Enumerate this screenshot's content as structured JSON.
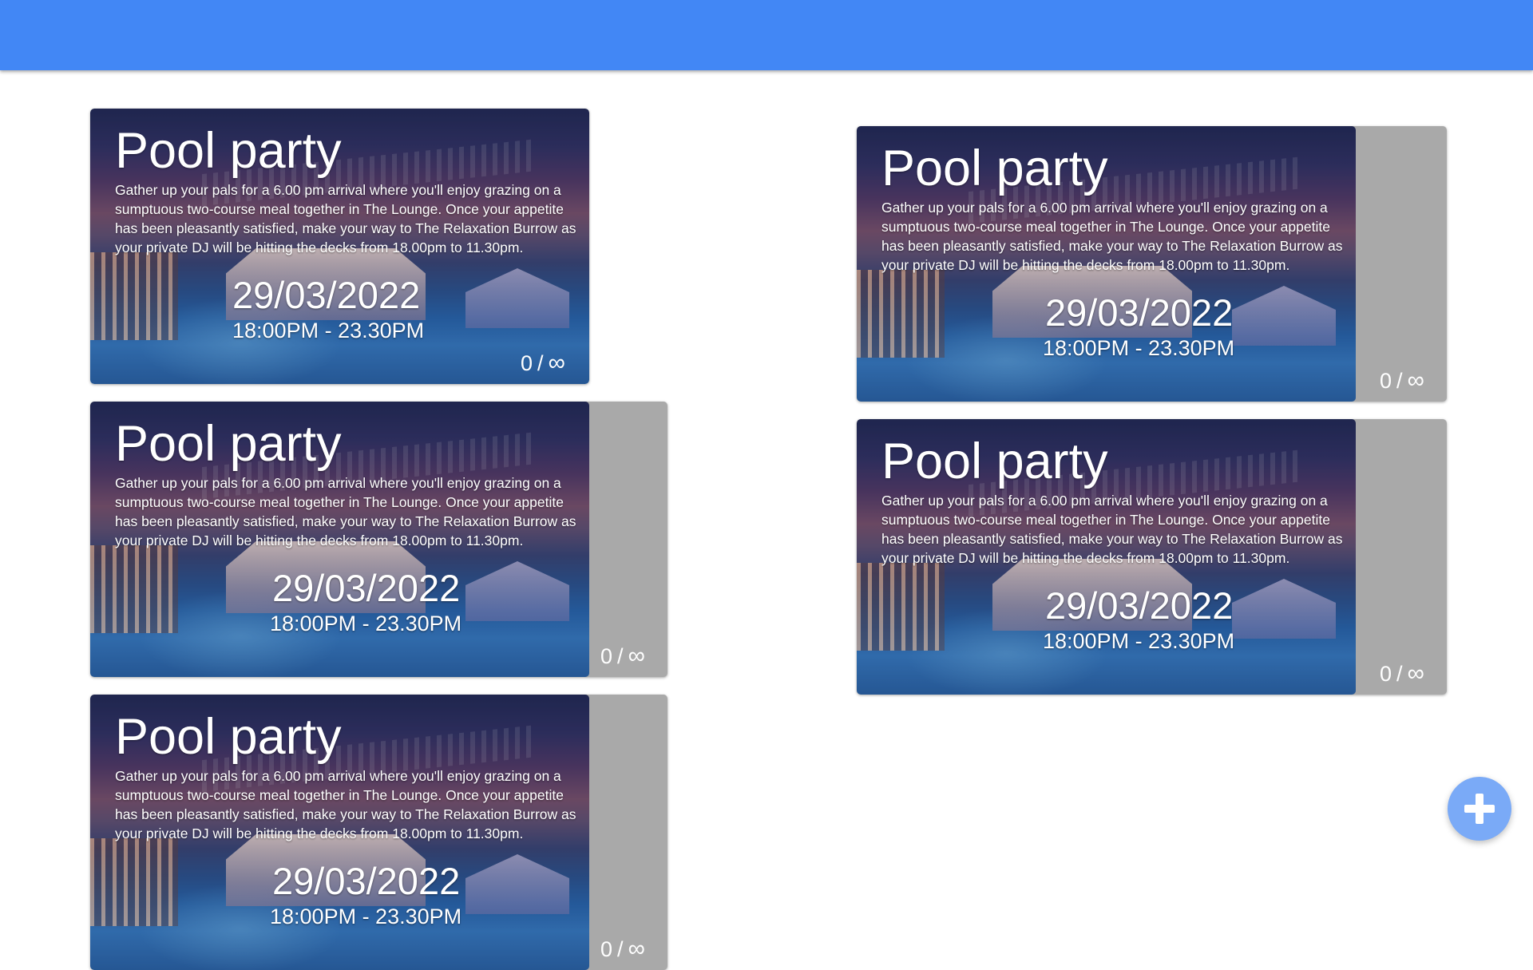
{
  "header": {
    "color": "#4287f5"
  },
  "events": [
    {
      "title": "Pool party",
      "description": "Gather up your pals for a 6.00 pm arrival where you'll enjoy grazing on a sumptuous two-course meal together in The Lounge. Once your appetite has been pleasantly satisfied, make your way to The Relaxation Burrow as your private DJ will be hitting the decks from 18.00pm to 11.30pm.",
      "date": "29/03/2022",
      "time": "18:00PM - 23.30PM",
      "booked": "0",
      "capacity_symbol": "∞"
    },
    {
      "title": "Pool party",
      "description": "Gather up your pals for a 6.00 pm arrival where you'll enjoy grazing on a sumptuous two-course meal together in The Lounge. Once your appetite has been pleasantly satisfied, make your way to The Relaxation Burrow as your private DJ will be hitting the decks from 18.00pm to 11.30pm.",
      "date": "29/03/2022",
      "time": "18:00PM - 23.30PM",
      "booked": "0",
      "capacity_symbol": "∞"
    },
    {
      "title": "Pool party",
      "description": "Gather up your pals for a 6.00 pm arrival where you'll enjoy grazing on a sumptuous two-course meal together in The Lounge. Once your appetite has been pleasantly satisfied, make your way to The Relaxation Burrow as your private DJ will be hitting the decks from 18.00pm to 11.30pm.",
      "date": "29/03/2022",
      "time": "18:00PM - 23.30PM",
      "booked": "0",
      "capacity_symbol": "∞"
    },
    {
      "title": "Pool party",
      "description": "Gather up your pals for a 6.00 pm arrival where you'll enjoy grazing on a sumptuous two-course meal together in The Lounge. Once your appetite has been pleasantly satisfied, make your way to The Relaxation Burrow as your private DJ will be hitting the decks from 18.00pm to 11.30pm.",
      "date": "29/03/2022",
      "time": "18:00PM - 23.30PM",
      "booked": "0",
      "capacity_symbol": "∞"
    },
    {
      "title": "Pool party",
      "description": "Gather up your pals for a 6.00 pm arrival where you'll enjoy grazing on a sumptuous two-course meal together in The Lounge. Once your appetite has been pleasantly satisfied, make your way to The Relaxation Burrow as your private DJ will be hitting the decks from 18.00pm to 11.30pm.",
      "date": "29/03/2022",
      "time": "18:00PM - 23.30PM",
      "booked": "0",
      "capacity_symbol": "∞"
    }
  ],
  "fab": {
    "icon": "plus-icon",
    "color": "#7aaaf7"
  }
}
